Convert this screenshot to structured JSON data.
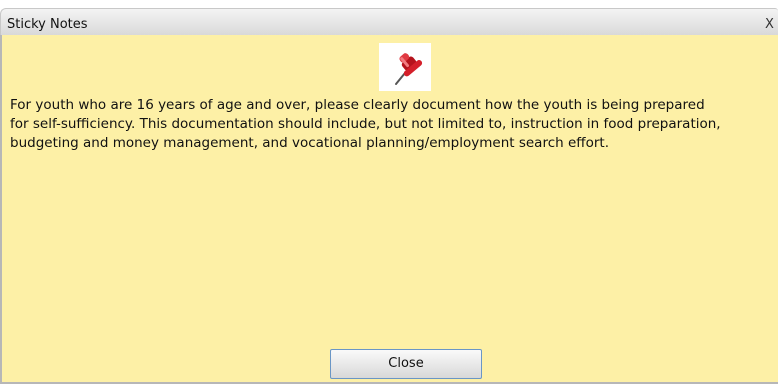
{
  "dialog": {
    "title": "Sticky Notes",
    "close_glyph": "X",
    "pin_icon": "pushpin-icon",
    "message": "For youth who are 16 years of age and over, please clearly document how the youth is being prepared\nfor self-sufficiency. This documentation should include, but not limited to, instruction in food preparation,\nbudgeting and money management, and vocational planning/employment search effort.",
    "close_button_label": "Close"
  },
  "colors": {
    "note_background": "#fdf0a6",
    "titlebar": "#e2e2e2",
    "button_border": "#6a96c6",
    "pin": "#d41f2a"
  }
}
